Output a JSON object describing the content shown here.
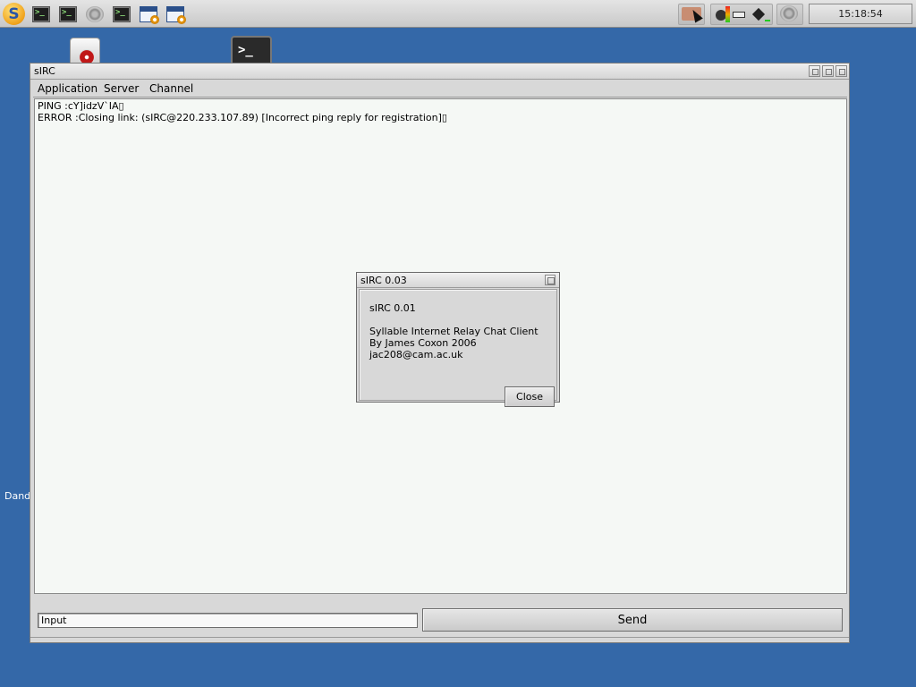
{
  "taskbar": {
    "logo": "S",
    "launchers": [
      {
        "icon": "terminal-icon"
      },
      {
        "icon": "terminal-icon"
      },
      {
        "icon": "speaker-icon"
      },
      {
        "icon": "terminal-icon"
      },
      {
        "icon": "preferences-icon"
      },
      {
        "icon": "preferences-icon"
      }
    ],
    "clock": "15:18:54"
  },
  "desktop": {
    "label_partial": "Dand"
  },
  "window": {
    "title": "sIRC",
    "menu": [
      "Application",
      "Server",
      "Channel"
    ],
    "output_lines": [
      "PING :cY]idzV`IA▯",
      "ERROR :Closing link: (sIRC@220.233.107.89) [Incorrect ping reply for registration]▯"
    ],
    "input_value": "Input",
    "send_label": "Send"
  },
  "dialog": {
    "title": "sIRC 0.03",
    "version": "sIRC 0.01",
    "description": "Syllable Internet Relay Chat Client",
    "author": "By James Coxon 2006",
    "email": "jac208@cam.ac.uk",
    "close_label": "Close"
  },
  "colors": {
    "desktop": "#3468a8",
    "window_bg": "#d8d8d8",
    "output_bg": "#f5f8f5"
  }
}
